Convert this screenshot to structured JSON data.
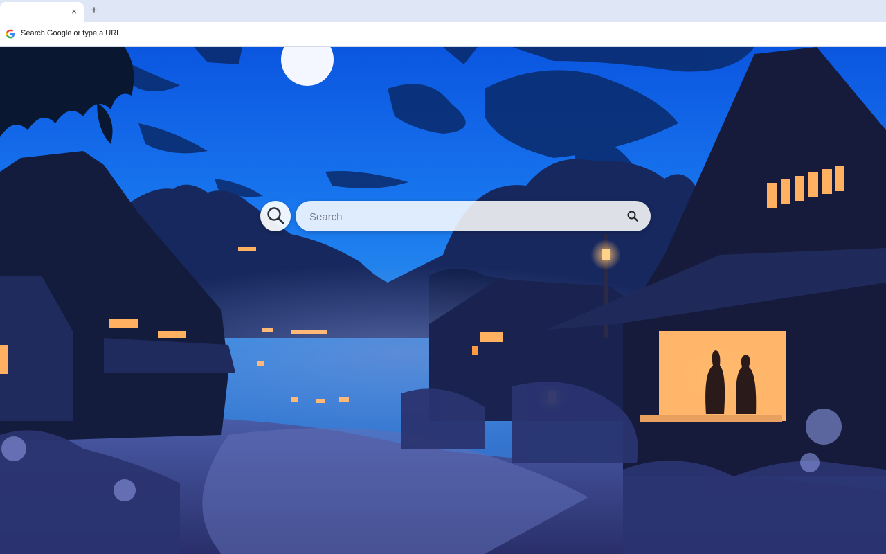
{
  "browser": {
    "tab": {
      "close_glyph": "×",
      "close_icon": "close-icon"
    },
    "new_tab": {
      "glyph": "+",
      "icon": "plus-icon"
    },
    "omnibox": {
      "placeholder_text": "Search Google or type a URL",
      "icon": "google-g-icon"
    }
  },
  "newtab_page": {
    "search": {
      "placeholder": "Search",
      "logo_icon": "magnifier-logo-icon",
      "button_icon": "search-icon"
    },
    "background": {
      "description_colors": {
        "sky": "#1f6fe8",
        "night": "#0d1a3a",
        "lamp": "#ffb060"
      }
    }
  }
}
